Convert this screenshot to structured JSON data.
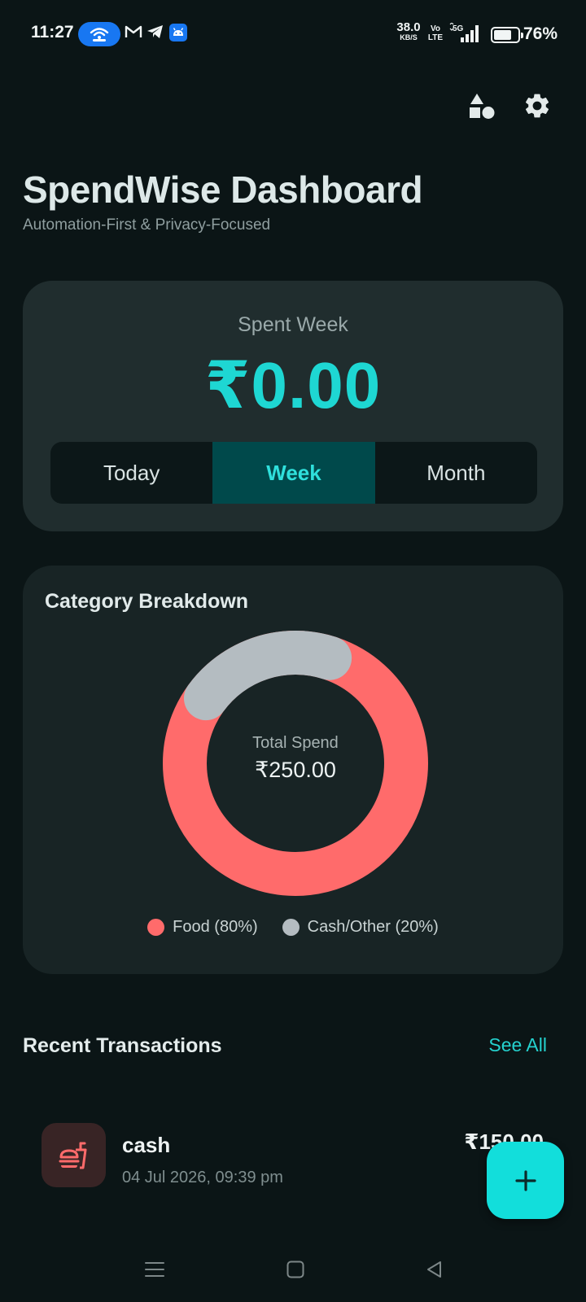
{
  "status_bar": {
    "time": "11:27",
    "net_speed_value": "38.0",
    "net_speed_unit": "KB/S",
    "volte_top": "Vo",
    "volte_bottom": "LTE",
    "network_type": "5G",
    "battery_percent": "76%",
    "battery_level": 0.76,
    "notification_icons": [
      "hotspot-icon",
      "gmail-icon",
      "telegram-icon",
      "android-icon"
    ]
  },
  "top_actions": {
    "shapes_icon": "shapes-icon",
    "settings_icon": "gear-icon"
  },
  "header": {
    "title": "SpendWise Dashboard",
    "subtitle": "Automation-First & Privacy-Focused"
  },
  "spent_card": {
    "label": "Spent Week",
    "value": "₹0.00",
    "tabs": [
      {
        "label": "Today",
        "active": false
      },
      {
        "label": "Week",
        "active": true
      },
      {
        "label": "Month",
        "active": false
      }
    ]
  },
  "category_breakdown": {
    "title": "Category Breakdown",
    "center_label": "Total Spend",
    "center_value": "₹250.00",
    "legend": [
      {
        "label": "Food (80%)",
        "color": "#ff6b6b"
      },
      {
        "label": "Cash/Other (20%)",
        "color": "#b4bcc1"
      }
    ]
  },
  "chart_data": {
    "type": "pie",
    "categories": [
      "Food",
      "Cash/Other"
    ],
    "values": [
      80,
      20
    ],
    "colors": [
      "#ff6b6b",
      "#b4bcc1"
    ],
    "title": "Category Breakdown"
  },
  "recent_transactions": {
    "title": "Recent Transactions",
    "see_all_label": "See All",
    "items": [
      {
        "name": "cash",
        "date": "04 Jul 2026, 09:39 pm",
        "amount": "₹150.00",
        "icon": "fastfood-icon"
      }
    ]
  },
  "fab": {
    "label": "+"
  },
  "colors": {
    "accent": "#1ed7d3",
    "background": "#0b1516",
    "card": "#202d2e",
    "food": "#ff6b6b",
    "other": "#b4bcc1"
  }
}
